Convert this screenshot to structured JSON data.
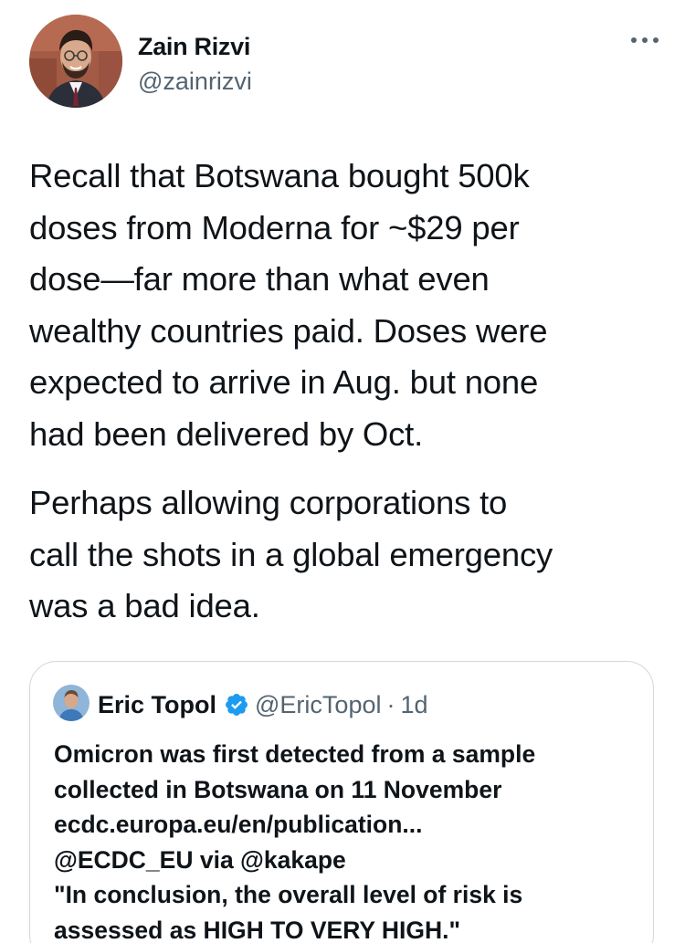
{
  "author": {
    "name": "Zain Rizvi",
    "handle": "@zainrizvi",
    "more_icon": "more-horizontal-icon"
  },
  "tweet": {
    "paragraphs": [
      "Recall that Botswana bought 500k\ndoses from Moderna for ~$29 per\ndose—far more than what even\nwealthy countries paid. Doses were\nexpected to arrive in Aug. but none\nhad been delivered by Oct.",
      "Perhaps allowing corporations to\ncall the shots in a global emergency\nwas a bad idea."
    ]
  },
  "quoted": {
    "name": "Eric Topol",
    "verified_icon": "verified-badge-icon",
    "handle": "@EricTopol",
    "separator": "·",
    "time": "1d",
    "lines": [
      "Omicron was first detected from a sample",
      "collected in Botswana on 11 November",
      "ecdc.europa.eu/en/publication...",
      "@ECDC_EU via @kakape",
      "\"In conclusion, the overall level of risk is",
      "assessed as HIGH TO VERY HIGH.\""
    ]
  },
  "colors": {
    "text": "#0f1419",
    "secondary": "#536471",
    "border": "#cfd9de",
    "verified": "#1d9bf0"
  }
}
